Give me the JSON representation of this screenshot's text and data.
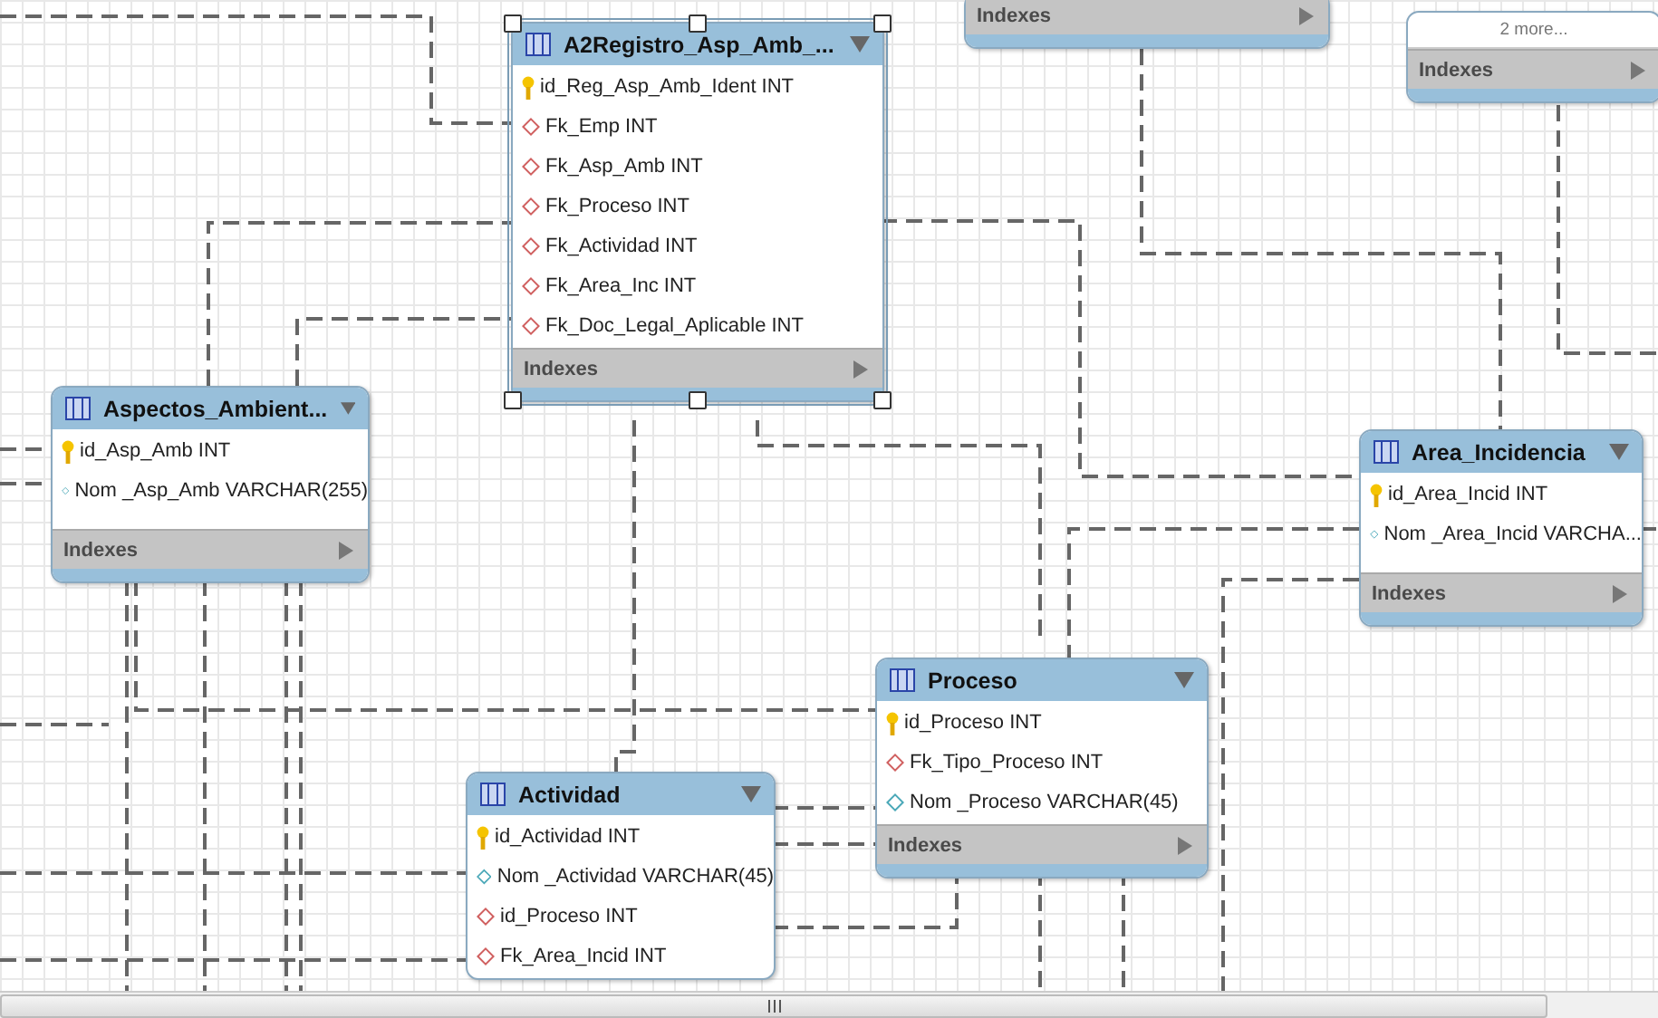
{
  "tables": [
    {
      "selected": false,
      "indexes_label": "Indexes"
    },
    {
      "selected": false,
      "more": "2 more...",
      "indexes_label": "Indexes"
    },
    {
      "title": "A2Registro_Asp_Amb_...",
      "selected": true,
      "columns": [
        {
          "kind": "pk",
          "text": "id_Reg_Asp_Amb_Ident INT"
        },
        {
          "kind": "fk",
          "text": "Fk_Emp INT"
        },
        {
          "kind": "fk",
          "text": "Fk_Asp_Amb INT"
        },
        {
          "kind": "fk",
          "text": "Fk_Proceso INT"
        },
        {
          "kind": "fk",
          "text": "Fk_Actividad INT"
        },
        {
          "kind": "fk",
          "text": "Fk_Area_Inc INT"
        },
        {
          "kind": "fk",
          "text": "Fk_Doc_Legal_Aplicable INT"
        }
      ],
      "indexes_label": "Indexes"
    },
    {
      "title": "Aspectos_Ambient...",
      "selected": false,
      "columns": [
        {
          "kind": "pk",
          "text": "id_Asp_Amb INT"
        },
        {
          "kind": "attr",
          "text": "Nom _Asp_Amb VARCHAR(255)"
        }
      ],
      "indexes_label": "Indexes"
    },
    {
      "title": "Area_Incidencia",
      "selected": false,
      "columns": [
        {
          "kind": "pk",
          "text": "id_Area_Incid INT"
        },
        {
          "kind": "attr",
          "text": "Nom _Area_Incid VARCHA..."
        }
      ],
      "indexes_label": "Indexes"
    },
    {
      "title": "Proceso",
      "selected": false,
      "columns": [
        {
          "kind": "pk",
          "text": "id_Proceso INT"
        },
        {
          "kind": "fk",
          "text": "Fk_Tipo_Proceso INT"
        },
        {
          "kind": "attr",
          "text": "Nom _Proceso VARCHAR(45)"
        }
      ],
      "indexes_label": "Indexes"
    },
    {
      "title": "Actividad",
      "selected": false,
      "columns": [
        {
          "kind": "pk",
          "text": "id_Actividad INT"
        },
        {
          "kind": "attr",
          "text": "Nom _Actividad VARCHAR(45)"
        },
        {
          "kind": "fk",
          "text": "id_Proceso INT"
        },
        {
          "kind": "fk",
          "text": "Fk_Area_Incid INT"
        }
      ]
    }
  ]
}
